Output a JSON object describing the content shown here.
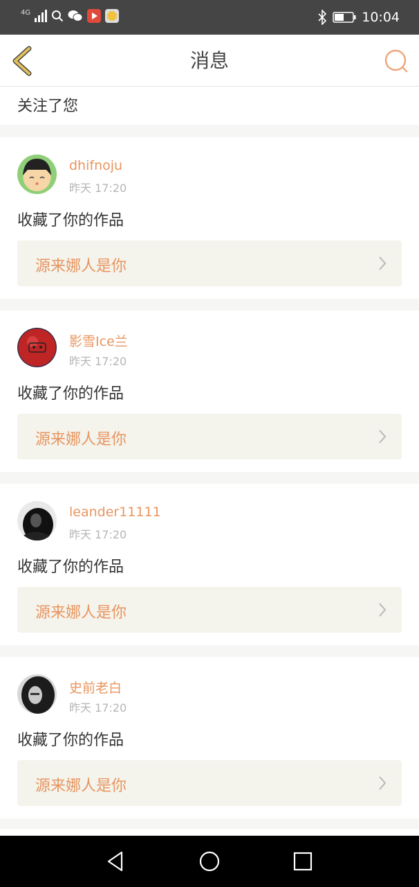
{
  "status_bar": {
    "network": "4G",
    "time": "10:04"
  },
  "header": {
    "title": "消息"
  },
  "partial_item": {
    "action": "关注了您"
  },
  "notifications": [
    {
      "user": "dhifnoju",
      "time": "昨天 17:20",
      "action": "收藏了你的作品",
      "work_title": "源来娜人是你"
    },
    {
      "user": "影雪Ice兰",
      "time": "昨天 17:20",
      "action": "收藏了你的作品",
      "work_title": "源来娜人是你"
    },
    {
      "user": "leander11111",
      "time": "昨天 17:20",
      "action": "收藏了你的作品",
      "work_title": "源来娜人是你"
    },
    {
      "user": "史前老白",
      "time": "昨天 17:20",
      "action": "收藏了你的作品",
      "work_title": "源来娜人是你"
    }
  ],
  "colors": {
    "accent": "#e8955f",
    "back_icon": "#e2c15a",
    "card_link_bg": "#f4f3ec",
    "status_bar": "#454545"
  }
}
